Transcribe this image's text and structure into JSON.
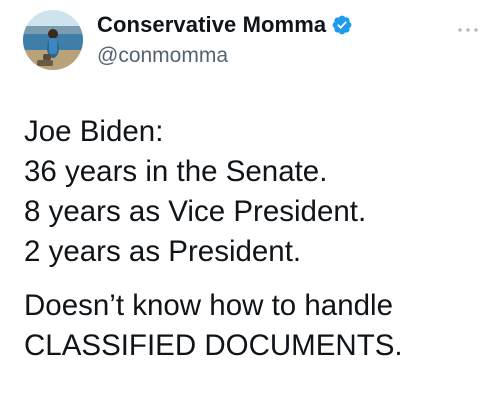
{
  "tweet": {
    "author": {
      "display_name": "Conservative Momma",
      "handle": "@conmomma",
      "verified_icon": "verified-badge-icon",
      "avatar_icon": "avatar-photo"
    },
    "more_icon": "more-options-icon",
    "text": {
      "lines": [
        "Joe Biden:",
        "36 years in the Senate.",
        "8 years as Vice President.",
        "2 years as President."
      ],
      "closing_lines": [
        "Doesn’t know how to handle",
        "CLASSIFIED DOCUMENTS."
      ]
    },
    "colors": {
      "text": "#0f1419",
      "secondary": "#536471",
      "verified": "#1d9bf0"
    }
  }
}
